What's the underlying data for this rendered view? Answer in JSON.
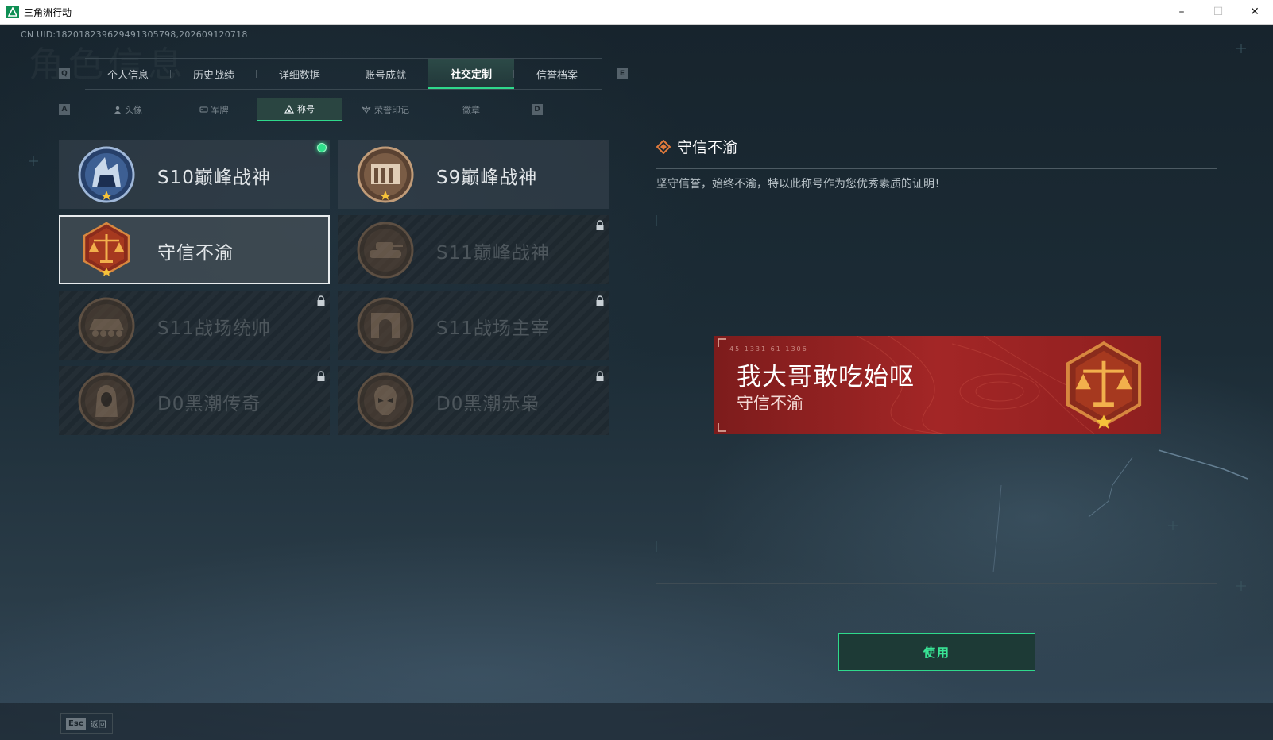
{
  "window": {
    "title": "三角洲行动",
    "minimize": "–",
    "maximize": "☐",
    "close": "✕"
  },
  "uid": "CN UID:182018239629491305798,202609120718",
  "watermark": "角色信息",
  "keys": {
    "prev_tab": "Q",
    "next_tab": "E",
    "prev_subtab": "A",
    "next_subtab": "D"
  },
  "tabs": [
    {
      "label": "个人信息"
    },
    {
      "label": "历史战绩"
    },
    {
      "label": "详细数据"
    },
    {
      "label": "账号成就"
    },
    {
      "label": "社交定制",
      "active": true
    },
    {
      "label": "信誉档案"
    }
  ],
  "subtabs": [
    {
      "label": "头像",
      "icon": "user-icon"
    },
    {
      "label": "军牌",
      "icon": "tag-icon"
    },
    {
      "label": "称号",
      "icon": "triangle-icon",
      "active": true
    },
    {
      "label": "荣誉印记",
      "icon": "wing-icon"
    },
    {
      "label": "徽章",
      "icon": ""
    }
  ],
  "titles": [
    {
      "name": "S10巅峰战神",
      "badge": "fortress-badge",
      "locked": false,
      "equipped": true,
      "palette": "blue"
    },
    {
      "name": "S9巅峰战神",
      "badge": "ruins-badge",
      "locked": false,
      "equipped": false,
      "palette": "bronze"
    },
    {
      "name": "守信不渝",
      "badge": "scales-badge",
      "locked": false,
      "selected": true,
      "palette": "red"
    },
    {
      "name": "S11巅峰战神",
      "badge": "tank-badge",
      "locked": true,
      "palette": "bronze"
    },
    {
      "name": "S11战场统帅",
      "badge": "apc-badge",
      "locked": true,
      "palette": "bronze"
    },
    {
      "name": "S11战场主宰",
      "badge": "arch-badge",
      "locked": true,
      "palette": "bronze"
    },
    {
      "name": "D0黑潮传奇",
      "badge": "hooded-figure-badge",
      "locked": true,
      "palette": "bronze"
    },
    {
      "name": "D0黑潮赤枭",
      "badge": "skull-mask-badge",
      "locked": true,
      "palette": "bronze"
    }
  ],
  "detail": {
    "title": "守信不渝",
    "description": "坚守信誉，始终不渝，特以此称号作为您优秀素质的证明！"
  },
  "banner": {
    "player_name": "我大哥敢吃始呕",
    "title": "守信不渝",
    "code": "45  1331    61  1306"
  },
  "actions": {
    "use": "使用",
    "back_key": "Esc",
    "back_label": "返回"
  },
  "colors": {
    "accent": "#2fd98c",
    "banner_red": "#a32626",
    "selected_border": "#e8ecee"
  }
}
